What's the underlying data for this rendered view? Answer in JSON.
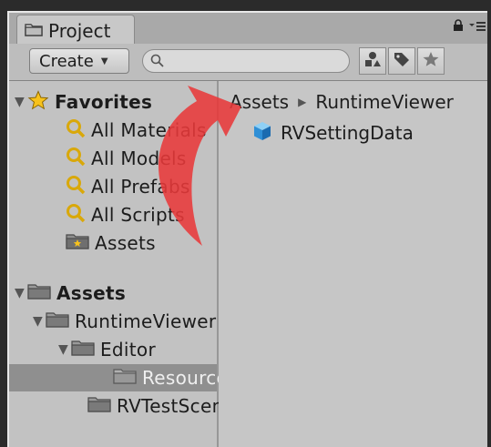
{
  "window": {
    "tab_title": "Project",
    "icons": [
      "folder-icon",
      "lock-icon",
      "menu-icon"
    ]
  },
  "toolbar": {
    "create_label": "Create",
    "search_placeholder": "",
    "buttons": [
      "filter-by-type-icon",
      "filter-by-label-icon",
      "favorite-star-icon"
    ]
  },
  "sidebar": {
    "favorites": {
      "label": "Favorites",
      "items": [
        {
          "label": "All Materials",
          "icon": "search-icon"
        },
        {
          "label": "All Models",
          "icon": "search-icon"
        },
        {
          "label": "All Prefabs",
          "icon": "search-icon"
        },
        {
          "label": "All Scripts",
          "icon": "search-icon"
        },
        {
          "label": "Assets",
          "icon": "favorite-folder-icon"
        }
      ]
    },
    "assets": {
      "label": "Assets",
      "tree": [
        {
          "label": "RuntimeViewer",
          "depth": 1,
          "icon": "folder-icon"
        },
        {
          "label": "Editor",
          "depth": 2,
          "icon": "folder-icon"
        },
        {
          "label": "Resources",
          "depth": 3,
          "icon": "folder-icon",
          "selected": true
        },
        {
          "label": "RVTestScenes",
          "depth": 2,
          "icon": "folder-icon"
        }
      ]
    }
  },
  "main": {
    "breadcrumb": [
      "Assets",
      "RuntimeViewer"
    ],
    "items": [
      {
        "label": "RVSettingData",
        "icon": "scriptable-object-cube-icon"
      }
    ]
  },
  "colors": {
    "arrow": "#e8393a",
    "panel": "#c2c2c2",
    "selection": "#8f8f8f"
  }
}
